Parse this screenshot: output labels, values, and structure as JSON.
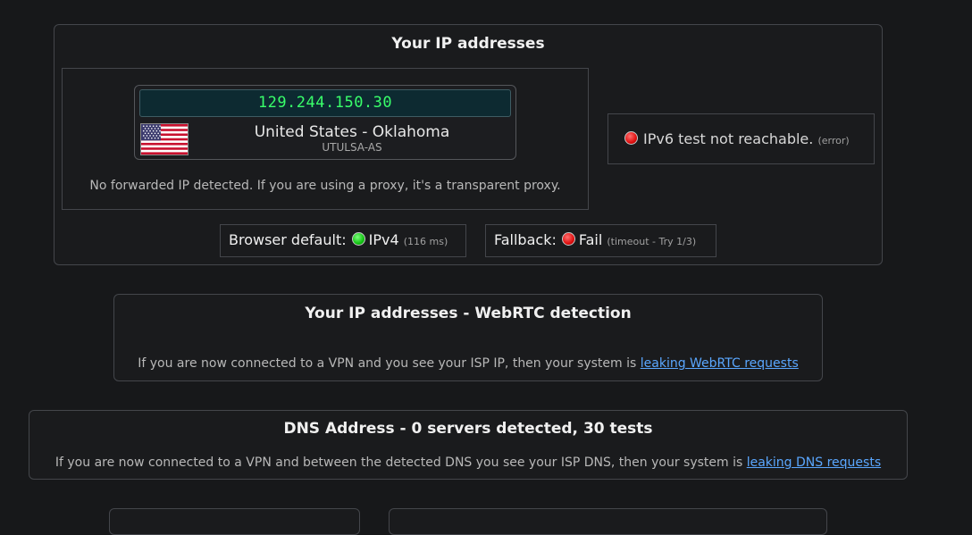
{
  "ip_section": {
    "title": "Your IP addresses",
    "ip_address": "129.244.150.30",
    "flag_icon": "us-flag-icon",
    "country": "United States - Oklahoma",
    "isp": "UTULSA-AS",
    "forwarded_text": "No forwarded IP detected. If you are using a proxy, it's a transparent proxy.",
    "ipv6": {
      "status_color": "#e01010",
      "text": "IPv6 test not reachable.",
      "note": "(error)"
    },
    "browser_default": {
      "label": "Browser default:",
      "status_color": "#12c212",
      "value": "IPv4",
      "note": "(116 ms)"
    },
    "fallback": {
      "label": "Fallback:",
      "status_color": "#e01010",
      "value": "Fail",
      "note": "(timeout - Try 1/3)"
    }
  },
  "webrtc_section": {
    "title": "Your IP addresses - WebRTC detection",
    "description": "If you are now connected to a VPN and you see your ISP IP, then your system is ",
    "link": "leaking WebRTC requests"
  },
  "dns_section": {
    "title": "DNS Address - 0 servers detected, 30 tests",
    "description": "If you are now connected to a VPN and between the detected DNS you see your ISP DNS, then your system is ",
    "link": "leaking DNS requests"
  },
  "colors": {
    "background": "#17181a",
    "ip_text": "#39ff6a",
    "link": "#5aa7ff"
  }
}
